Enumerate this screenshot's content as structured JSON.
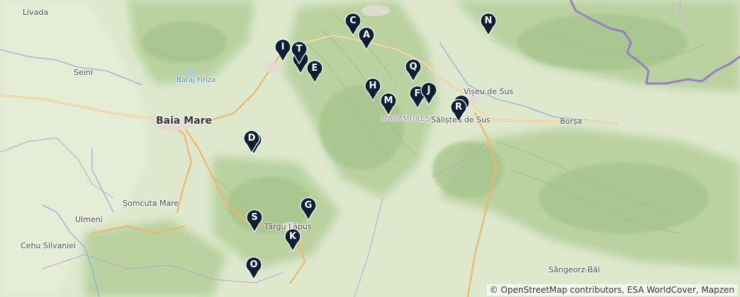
{
  "places": [
    {
      "key": "livada",
      "text": "Livada"
    },
    {
      "key": "seini",
      "text": "Seini"
    },
    {
      "key": "baraj_firiza",
      "text": "Baraj Firiza"
    },
    {
      "key": "baia_mare",
      "text": "Baia Mare"
    },
    {
      "key": "maramures",
      "text": "MARAMUREȘ"
    },
    {
      "key": "viseu_de_sus",
      "text": "Vișeu de Sus"
    },
    {
      "key": "salistea_de_sus",
      "text": "Săliștea de Sus"
    },
    {
      "key": "borsa",
      "text": "Borșa"
    },
    {
      "key": "somcuta_mare",
      "text": "Șomcuta Mare"
    },
    {
      "key": "ulmeni",
      "text": "Ulmeni"
    },
    {
      "key": "cehu_silvaniei",
      "text": "Cehu Silvaniei"
    },
    {
      "key": "targu_lapus",
      "text": "Târgu Lăpuș"
    },
    {
      "key": "sangeorz_bai",
      "text": "Sângeorz-Băi"
    }
  ],
  "markers": [
    "A",
    "C",
    "D",
    "E",
    "F",
    "G",
    "H",
    "I",
    "J",
    "K",
    "M",
    "N",
    "O",
    "Q",
    "R",
    "S",
    "T"
  ],
  "attribution": "© OpenStreetMap contributors, ESA WorldCover, Mapzen",
  "colors": {
    "marker_fill": "#0d1f35",
    "marker_text": "#ffffff",
    "forest": "#b5cf9c",
    "country_border": "#9a7fc0",
    "road": "#f2b66a"
  }
}
